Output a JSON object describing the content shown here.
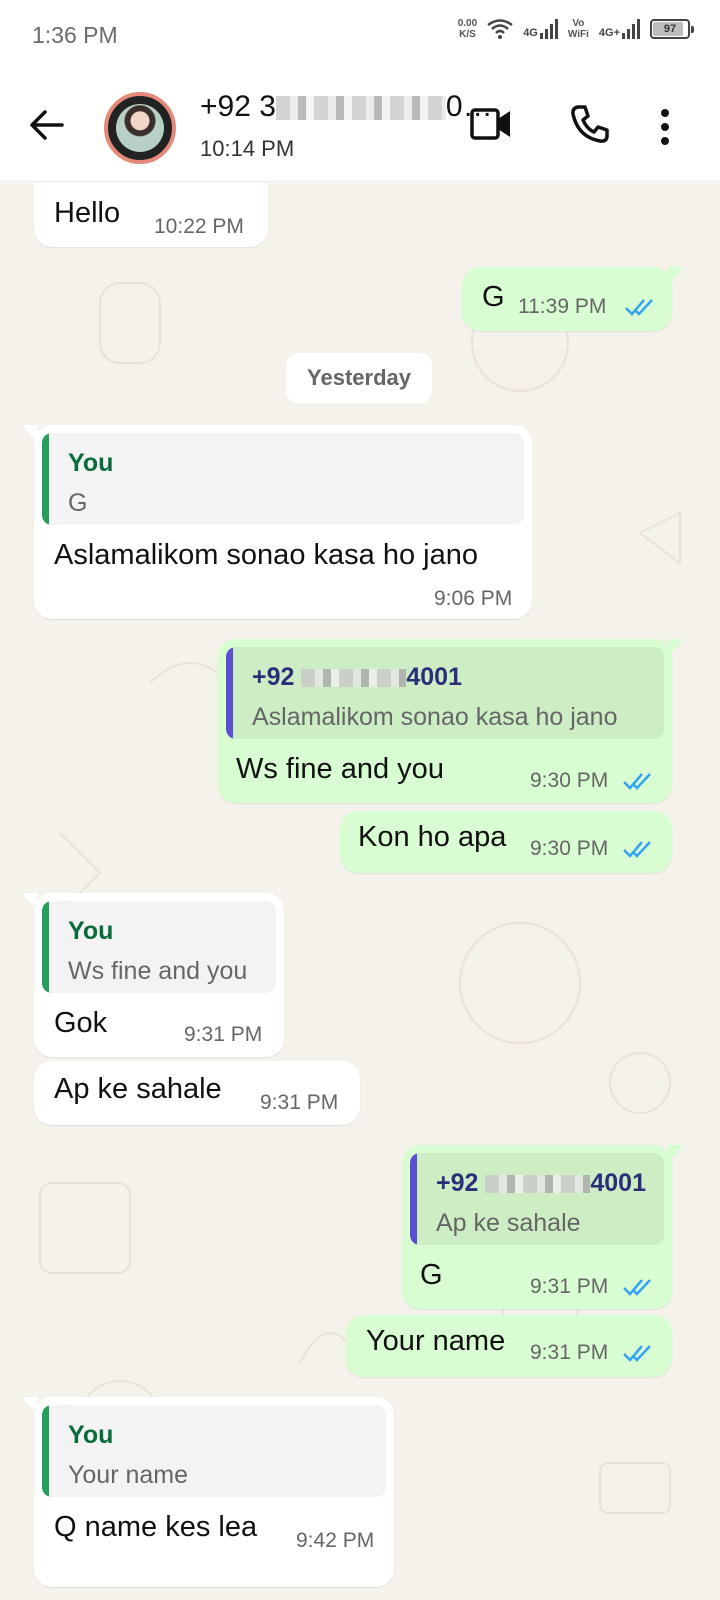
{
  "status": {
    "time": "1:36 PM",
    "net_speed_value": "0.00",
    "net_speed_unit": "K/S",
    "sim1": "4G",
    "vowifi_top": "Vo",
    "vowifi_bottom": "WiFi",
    "sim2": "4G+",
    "battery": "97"
  },
  "header": {
    "contact_prefix": "+92 3",
    "contact_suffix": "0…",
    "last_seen": "10:14 PM"
  },
  "colors": {
    "you_name": "#0a6b3b",
    "quote_bar_in": "#25a05a",
    "quote_bar_out": "#5b4fd1",
    "reply_name_out": "#2b2f7a",
    "tick_blue": "#34a4f0"
  },
  "messages": [
    {
      "dir": "in",
      "text": "Hello",
      "time": "10:22 PM"
    },
    {
      "dir": "out",
      "text": "G",
      "time": "11:39 PM"
    },
    {
      "date_divider": "Yesterday"
    },
    {
      "dir": "in",
      "quote_author": "You",
      "quote_text": "G",
      "text": "Aslamalikom sonao kasa ho jano",
      "time": "9:06 PM"
    },
    {
      "dir": "out",
      "quote_author_prefix": "+92",
      "quote_author_suffix": "4001",
      "quote_text": "Aslamalikom sonao kasa ho jano",
      "text": "Ws fine and you",
      "time": "9:30 PM"
    },
    {
      "dir": "out",
      "text": "Kon ho apa",
      "time": "9:30 PM"
    },
    {
      "dir": "in",
      "quote_author": "You",
      "quote_text": "Ws fine and you",
      "text": "Gok",
      "time": "9:31 PM"
    },
    {
      "dir": "in",
      "text": "Ap ke sahale",
      "time": "9:31 PM"
    },
    {
      "dir": "out",
      "quote_author_prefix": "+92",
      "quote_author_suffix": "4001",
      "quote_text": "Ap ke sahale",
      "text": "G",
      "time": "9:31 PM"
    },
    {
      "dir": "out",
      "text": "Your name",
      "time": "9:31 PM"
    },
    {
      "dir": "in",
      "quote_author": "You",
      "quote_text": "Your name",
      "text": "Q name kes lea",
      "time": "9:42 PM"
    }
  ]
}
